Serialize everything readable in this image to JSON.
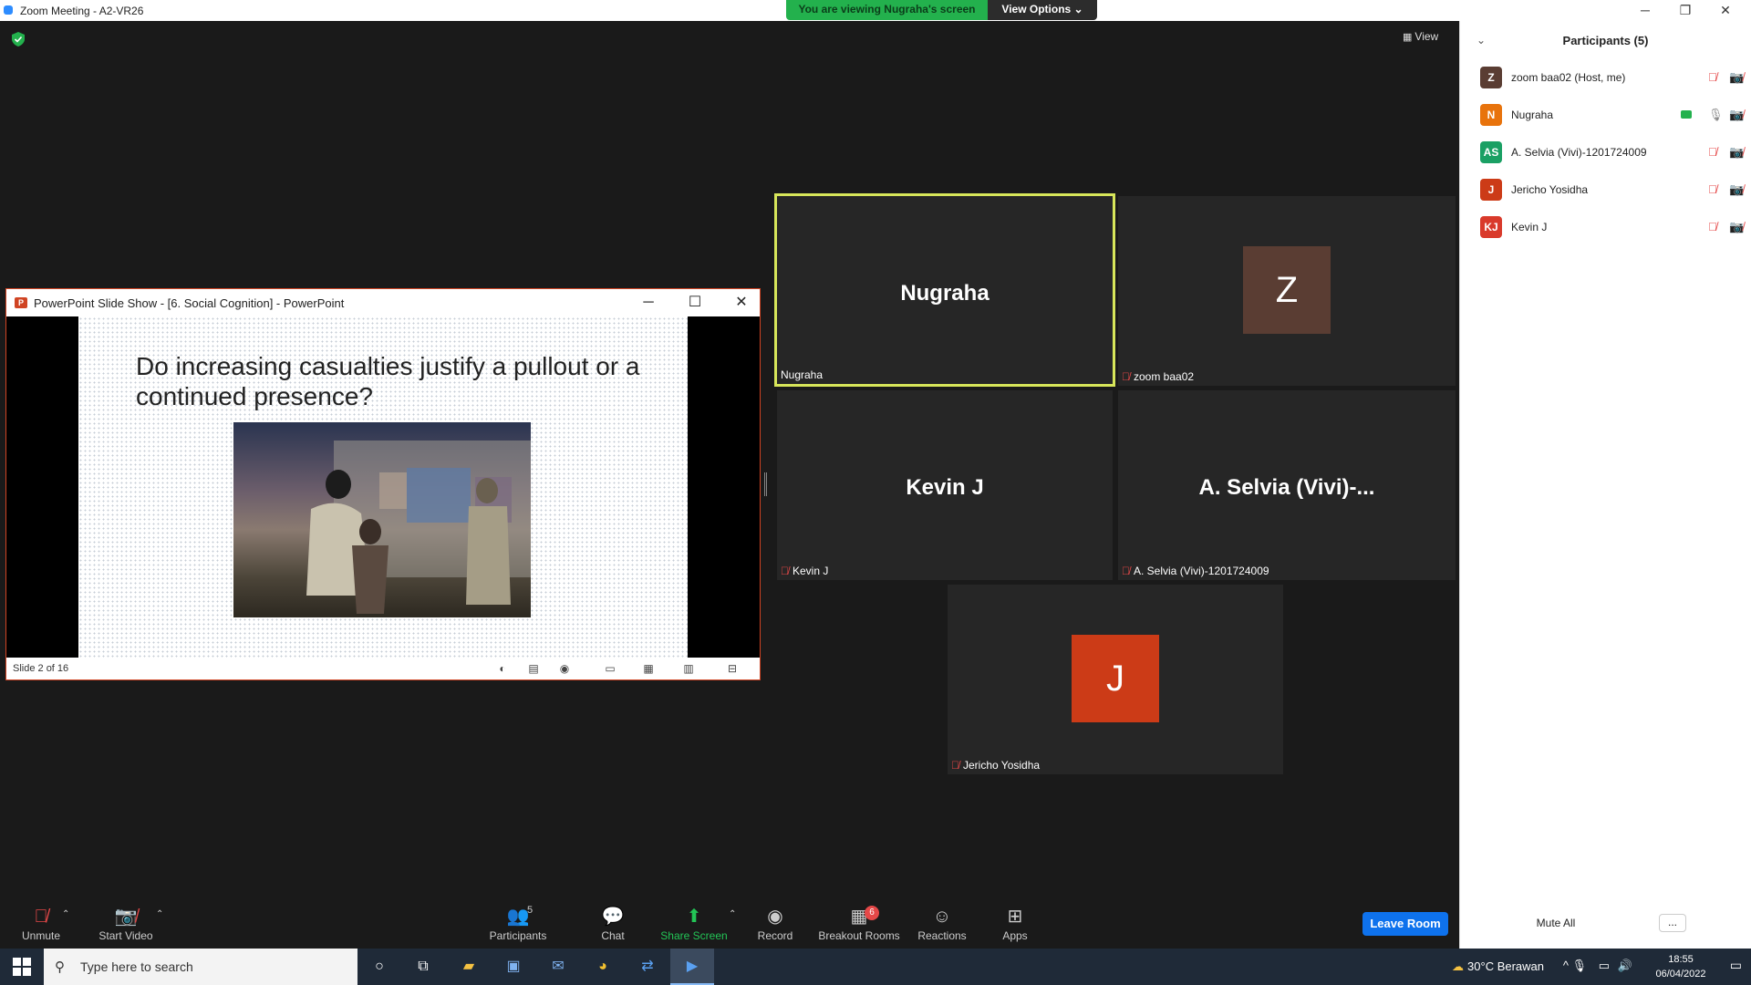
{
  "window": {
    "title": "Zoom Meeting - A2-VR26",
    "minimize": "─",
    "restore": "❐",
    "close": "✕"
  },
  "banner": {
    "viewing_text": "You are viewing Nugraha's screen",
    "view_options": "View Options ⌄"
  },
  "view_button": {
    "icon": "grid-icon",
    "label": "View"
  },
  "powerpoint": {
    "title": "PowerPoint Slide Show - [6. Social Cognition] - PowerPoint",
    "slide_heading": "Do increasing casualties justify a pullout or a continued presence?",
    "status": "Slide 2 of 16"
  },
  "tiles": {
    "nugraha": {
      "big_name": "Nugraha",
      "label": "Nugraha"
    },
    "zoom": {
      "initial": "Z",
      "label": "zoom baa02",
      "color": "#5a3d33"
    },
    "kevin": {
      "big_name": "Kevin J",
      "label": "Kevin J"
    },
    "selvia": {
      "big_name": "A. Selvia (Vivi)-...",
      "label": "A. Selvia (Vivi)-1201724009"
    },
    "jericho": {
      "initial": "J",
      "label": "Jericho Yosidha",
      "color": "#cc3b17"
    }
  },
  "participants": {
    "title": "Participants (5)",
    "items": [
      {
        "initials": "Z",
        "name": "zoom baa02 (Host, me)",
        "color": "#5a3d33"
      },
      {
        "initials": "N",
        "name": "Nugraha",
        "color": "#e8730c"
      },
      {
        "initials": "AS",
        "name": "A. Selvia (Vivi)-1201724009",
        "color": "#1aa064"
      },
      {
        "initials": "J",
        "name": "Jericho Yosidha",
        "color": "#cc3b17"
      },
      {
        "initials": "KJ",
        "name": "Kevin J",
        "color": "#d93a2b"
      }
    ],
    "mute_all": "Mute All",
    "more": "..."
  },
  "toolbar": {
    "unmute": "Unmute",
    "start_video": "Start Video",
    "participants": "Participants",
    "participants_count": "5",
    "chat": "Chat",
    "share_screen": "Share Screen",
    "record": "Record",
    "breakout_rooms": "Breakout Rooms",
    "breakout_badge": "6",
    "reactions": "Reactions",
    "apps": "Apps",
    "leave": "Leave Room"
  },
  "taskbar": {
    "search_placeholder": "Type here to search",
    "weather": "30°C  Berawan",
    "time": "18:55",
    "date": "06/04/2022"
  }
}
